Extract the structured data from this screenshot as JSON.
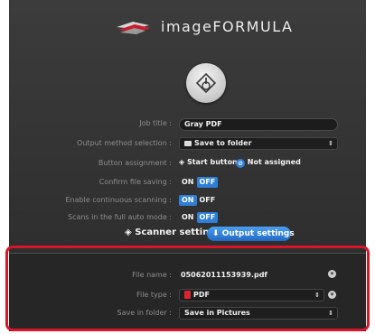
{
  "app": {
    "title": "imageFORMULA"
  },
  "settings": {
    "job_title": {
      "label": "Job title :",
      "value": "Gray PDF"
    },
    "output_method": {
      "label": "Output method selection :",
      "value": "Save to folder"
    },
    "button_assignment": {
      "label": "Button assignment :",
      "option_start": "Start button",
      "option_not": "Not assigned"
    },
    "confirm_saving": {
      "label": "Confirm file saving :",
      "on": "ON",
      "off": "OFF",
      "state": "OFF"
    },
    "continuous_scanning": {
      "label": "Enable continuous scanning :",
      "on": "ON",
      "off": "OFF",
      "state": "ON"
    },
    "full_auto": {
      "label": "Scans in the full auto mode :",
      "on": "ON",
      "off": "OFF",
      "state": "OFF"
    }
  },
  "actions": {
    "scanner_setting": "Scanner setting",
    "output_settings": "Output settings"
  },
  "output": {
    "file_name": {
      "label": "File name :",
      "value": "05062011153939.pdf"
    },
    "file_type": {
      "label": "File type :",
      "value": "PDF"
    },
    "save_folder": {
      "label": "Save in folder :",
      "value": "Save in Pictures"
    }
  },
  "colors": {
    "accent": "#2f7fd6",
    "highlight": "#d6162a",
    "background": "#333333"
  }
}
